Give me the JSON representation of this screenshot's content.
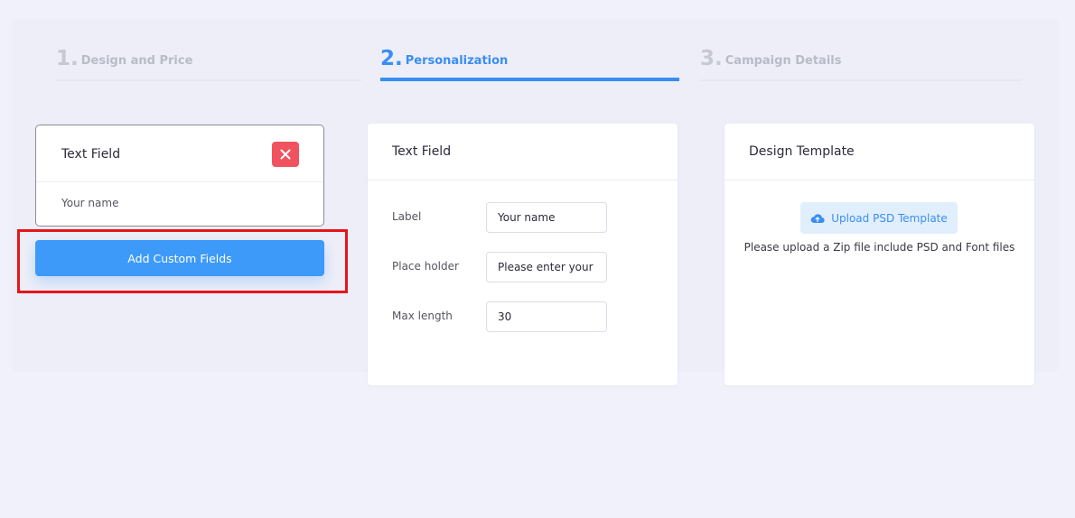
{
  "stepper": {
    "steps": [
      {
        "number": "1.",
        "label": "Design and Price",
        "state": "inactive"
      },
      {
        "number": "2.",
        "label": "Personalization",
        "state": "active"
      },
      {
        "number": "3.",
        "label": "Campaign Details",
        "state": "inactive"
      }
    ]
  },
  "field_card": {
    "title": "Text Field",
    "value": "Your name",
    "close_icon": "close-icon"
  },
  "add_custom_fields": {
    "label": "Add Custom Fields"
  },
  "text_field_panel": {
    "title": "Text Field",
    "rows": [
      {
        "label": "Label",
        "value": "Your name"
      },
      {
        "label": "Place holder",
        "value": "Please enter your name"
      },
      {
        "label": "Max length",
        "value": "30"
      }
    ]
  },
  "design_template_panel": {
    "title": "Design Template",
    "upload_label": "Upload PSD Template",
    "upload_icon": "cloud-upload-icon",
    "note": "Please upload a Zip file include PSD and Font files"
  },
  "colors": {
    "accent": "#3a8ef2",
    "button": "#3d9af8",
    "danger": "#f0525f",
    "highlight": "#e8141b",
    "background": "#f0f1fa"
  }
}
